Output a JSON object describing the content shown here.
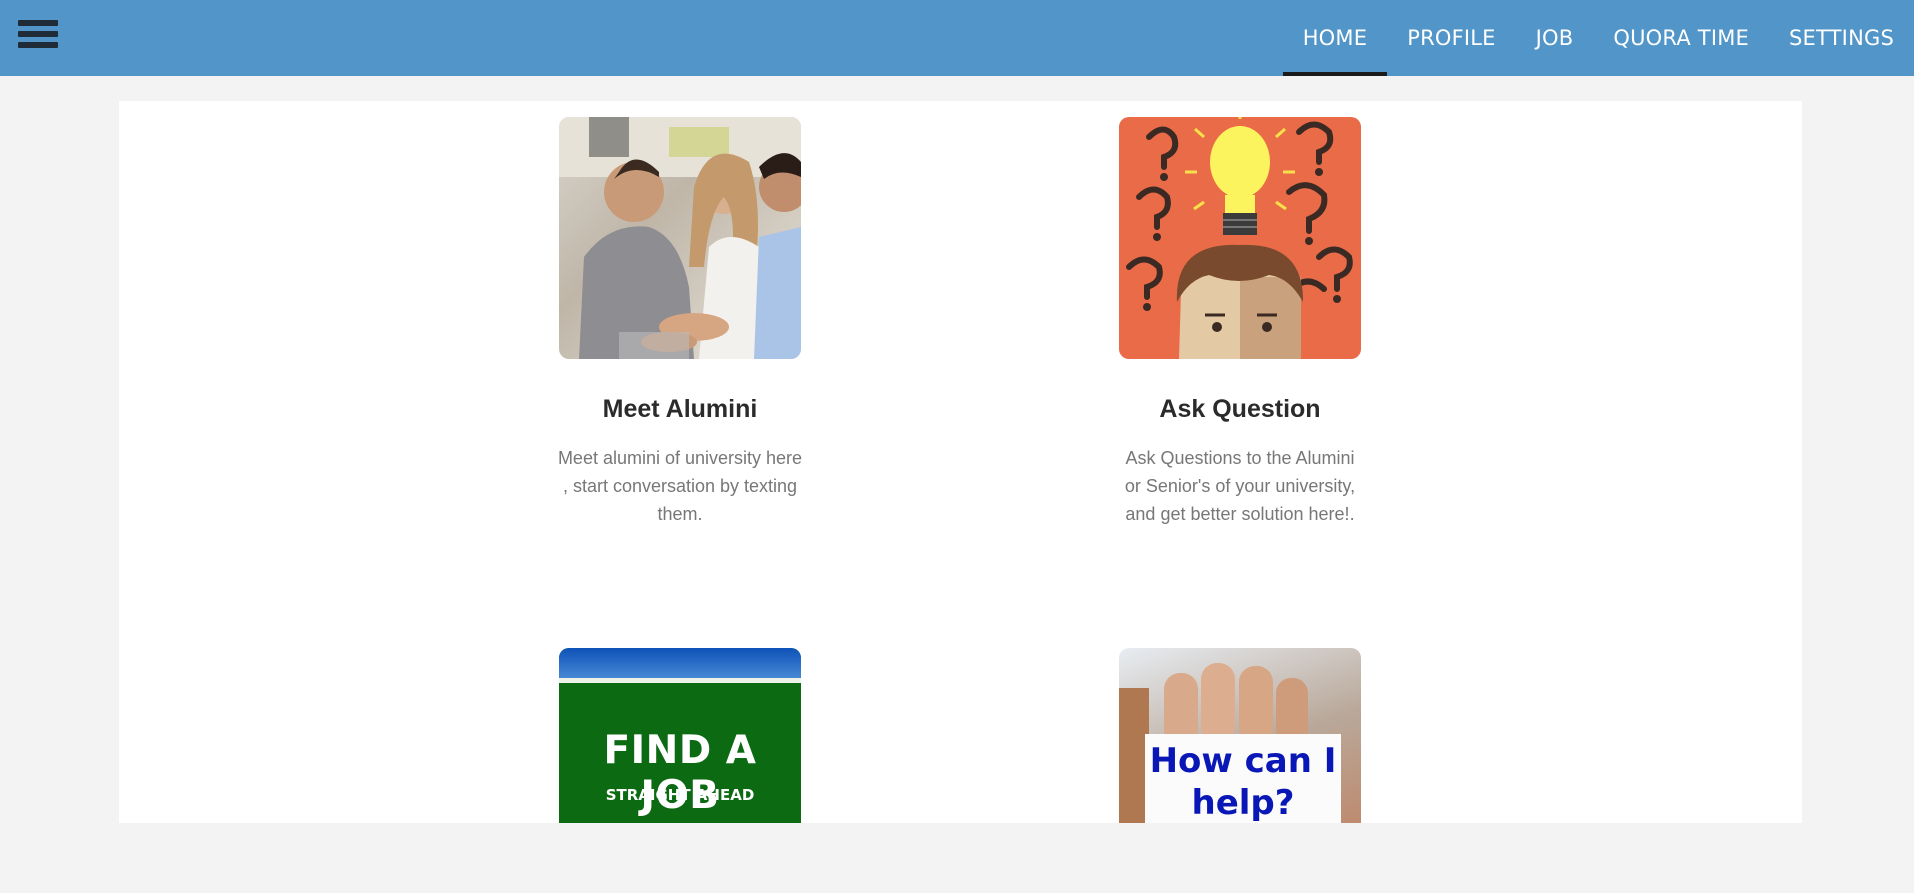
{
  "nav": {
    "menu_icon": "hamburger-menu-icon",
    "links": [
      {
        "label": "HOME",
        "active": true
      },
      {
        "label": "PROFILE",
        "active": false
      },
      {
        "label": "JOB",
        "active": false
      },
      {
        "label": "QUORA TIME",
        "active": false
      },
      {
        "label": "SETTINGS",
        "active": false
      }
    ]
  },
  "cards": [
    {
      "title": "Meet Alumini",
      "description": "Meet alumini of university here , start conversation by texting them.",
      "image": "people-handshake-image"
    },
    {
      "title": "Ask Question",
      "description": "Ask Questions to the Alumini or Senior's of your university, and get better solution here!.",
      "image": "lightbulb-question-marks-image"
    },
    {
      "image": "find-a-job-sign-image",
      "image_text": "FIND A JOB",
      "image_subtext": "STRAIGHT AHEAD"
    },
    {
      "image": "how-can-i-help-card-image",
      "image_text": "How can I help?"
    }
  ],
  "colors": {
    "navbar": "#5195c9",
    "page_bg": "#f3f3f3",
    "panel_bg": "#ffffff",
    "active_underline": "#1b1b1b"
  }
}
